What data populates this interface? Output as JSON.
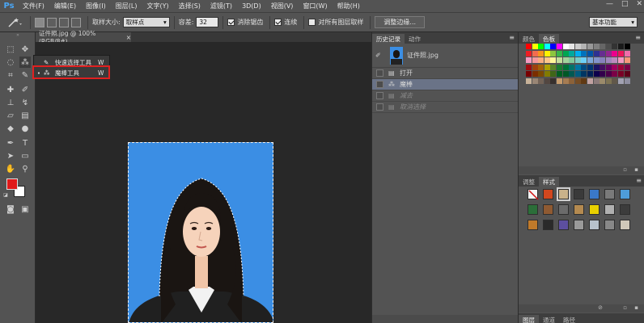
{
  "app": {
    "logo": "Ps",
    "menu": [
      "文件(F)",
      "编辑(E)",
      "图像(I)",
      "图层(L)",
      "文字(Y)",
      "选择(S)",
      "滤镜(T)",
      "3D(D)",
      "视图(V)",
      "窗口(W)",
      "帮助(H)"
    ],
    "window_controls": [
      "—",
      "□",
      "✕"
    ]
  },
  "options": {
    "sample_size_label": "取样大小:",
    "sample_size_value": "取样点",
    "tolerance_label": "容差:",
    "tolerance_value": "32",
    "antialias_label": "消除锯齿",
    "antialias_checked": true,
    "contiguous_label": "连续",
    "contiguous_checked": true,
    "sample_all_label": "对所有图层取样",
    "sample_all_checked": false,
    "refine_edge_button": "调整边缘...",
    "workspace": "基本功能"
  },
  "flyout": {
    "items": [
      {
        "label": "快速选择工具",
        "shortcut": "W",
        "current": false
      },
      {
        "label": "魔棒工具",
        "shortcut": "W",
        "current": true
      }
    ]
  },
  "document": {
    "tab_title": "证件照.jpg @ 100%(RGB/8#)",
    "close_glyph": "×"
  },
  "history": {
    "tabs": [
      "历史记录",
      "动作"
    ],
    "snapshot_label": "证件照.jpg",
    "steps": [
      {
        "label": "打开",
        "state": "normal"
      },
      {
        "label": "魔棒",
        "state": "current"
      },
      {
        "label": "减去",
        "state": "undone"
      },
      {
        "label": "取消选择",
        "state": "undone"
      }
    ]
  },
  "swatches_panel": {
    "tabs": [
      "颜色",
      "色板"
    ],
    "colors": {
      "row1": [
        "#ff0000",
        "#ffff00",
        "#00ff00",
        "#00ffff",
        "#0000ff",
        "#ff00ff",
        "#ffffff",
        "#e6e6e6",
        "#cccccc",
        "#b3b3b3",
        "#999999",
        "#808080",
        "#666666",
        "#4d4d4d",
        "#333333",
        "#1a1a1a",
        "#000000"
      ],
      "row2": [
        "#ee1d24",
        "#f26c4f",
        "#f7941d",
        "#fff200",
        "#8dc63f",
        "#39b54a",
        "#00a651",
        "#00a99d",
        "#00aeef",
        "#0072bc",
        "#0054a6",
        "#2e3192",
        "#662d91",
        "#92278f",
        "#ec008c",
        "#ed145b",
        "#f06eaa"
      ],
      "row3": [
        "#f49ac1",
        "#f5989d",
        "#f9ad81",
        "#fdc68a",
        "#fff799",
        "#c4df9b",
        "#a3d39c",
        "#82ca9c",
        "#7accc8",
        "#6dcff6",
        "#7da7d9",
        "#8393ca",
        "#8781bd",
        "#a186be",
        "#bd8cbf",
        "#f49ac2",
        "#f7977a"
      ],
      "row4": [
        "#9e0b0f",
        "#a0410d",
        "#a36209",
        "#aba000",
        "#598527",
        "#1a7b30",
        "#007236",
        "#00746b",
        "#0076a3",
        "#004a80",
        "#003471",
        "#1b1464",
        "#440e62",
        "#630460",
        "#9e005d",
        "#9e0039",
        "#7b0046"
      ],
      "row5": [
        "#790000",
        "#7b2e00",
        "#7d4900",
        "#827b00",
        "#406618",
        "#005e20",
        "#005826",
        "#005952",
        "#005b7f",
        "#003663",
        "#002157",
        "#0d004c",
        "#32004b",
        "#4b0049",
        "#7b0046",
        "#7a0026",
        "#5c0019"
      ],
      "row6": [
        "#c7b299",
        "#998675",
        "#736357",
        "#534741",
        "#37302d",
        "#c69c6d",
        "#a67c52",
        "#8c6239",
        "#754c24",
        "#603913",
        "#c2a2a2",
        "#8b7a7a",
        "#9b8b6b",
        "#7d7353",
        "#61584a",
        "#a2a2b2",
        "#8e8ea0"
      ]
    }
  },
  "styles_panel": {
    "tabs": [
      "调整",
      "样式"
    ],
    "cells": [
      {
        "color": "#f4f4f4",
        "icon": "none-icon"
      },
      {
        "color": "#d2471e"
      },
      {
        "color": "#c9b28a",
        "selected": true
      },
      {
        "color": "#3a3a3a"
      },
      {
        "color": "#3a78c8"
      },
      {
        "color": "#7a7a7a"
      },
      {
        "color": "#4e9cd8"
      },
      {
        "color": "#2b6e39"
      },
      {
        "color": "#8f5a32"
      },
      {
        "color": "#6b6b6b"
      },
      {
        "color": "#b48a50"
      },
      {
        "color": "#e8d000"
      },
      {
        "color": "#b0b0b0"
      },
      {
        "color": "#3c3c3c"
      },
      {
        "color": "#c07a2a"
      },
      {
        "color": "#2a2a2a"
      },
      {
        "color": "#5d4fa0"
      },
      {
        "color": "#9a9a9a"
      },
      {
        "color": "#b7c2cc"
      },
      {
        "color": "#888888"
      },
      {
        "color": "#d0c8b8"
      }
    ]
  },
  "layers_panel": {
    "tabs": [
      "图层",
      "通道",
      "路径"
    ]
  }
}
